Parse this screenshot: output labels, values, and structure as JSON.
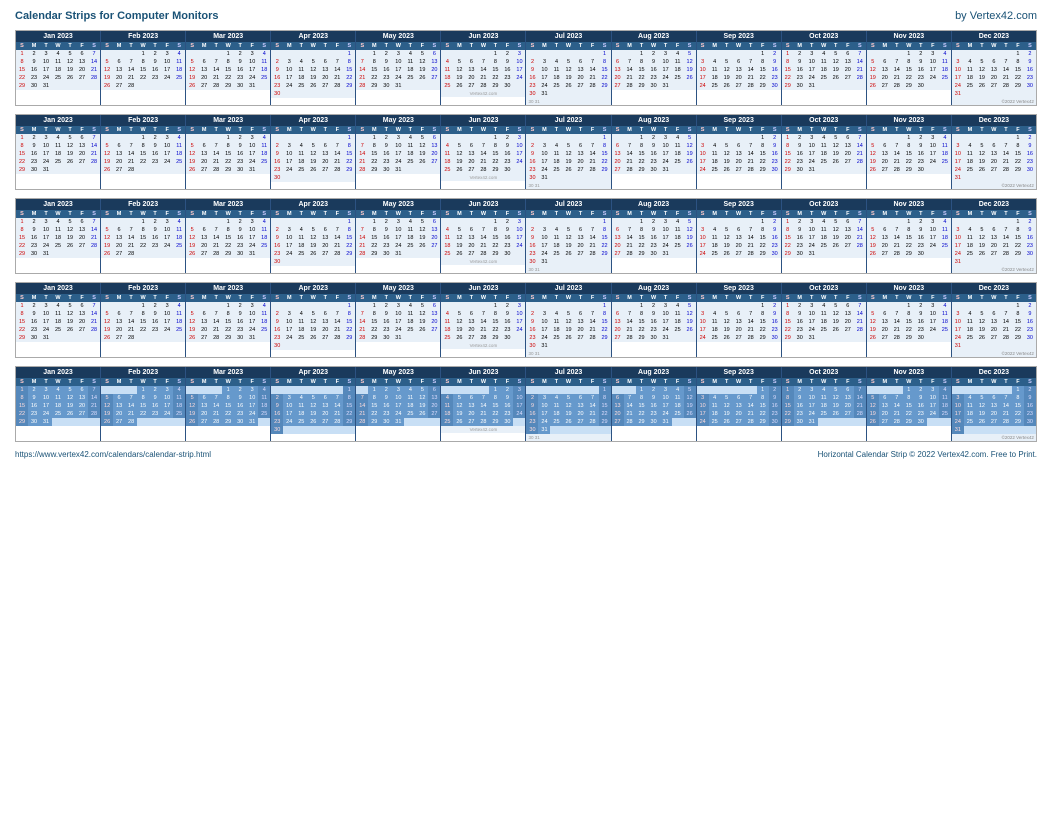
{
  "header": {
    "title": "Calendar Strips for Computer Monitors",
    "brand": "by Vertex42.com"
  },
  "months": [
    {
      "name": "Jan 2023",
      "startDay": 0,
      "days": 31
    },
    {
      "name": "Feb 2023",
      "startDay": 3,
      "days": 28
    },
    {
      "name": "Mar 2023",
      "startDay": 3,
      "days": 31
    },
    {
      "name": "Apr 2023",
      "startDay": 6,
      "days": 30
    },
    {
      "name": "May 2023",
      "startDay": 1,
      "days": 31
    },
    {
      "name": "Jun 2023",
      "startDay": 4,
      "days": 30
    },
    {
      "name": "Jul 2023",
      "startDay": 6,
      "days": 31
    },
    {
      "name": "Aug 2023",
      "startDay": 2,
      "days": 31
    },
    {
      "name": "Sep 2023",
      "startDay": 5,
      "days": 30
    },
    {
      "name": "Oct 2023",
      "startDay": 0,
      "days": 31
    },
    {
      "name": "Nov 2023",
      "startDay": 3,
      "days": 30
    },
    {
      "name": "Dec 2023",
      "startDay": 5,
      "days": 31
    }
  ],
  "footer": {
    "url": "https://www.vertex42.com/calendars/calendar-strip.html",
    "copyright": "Horizontal Calendar Strip © 2022 Vertex42.com. Free to Print."
  }
}
